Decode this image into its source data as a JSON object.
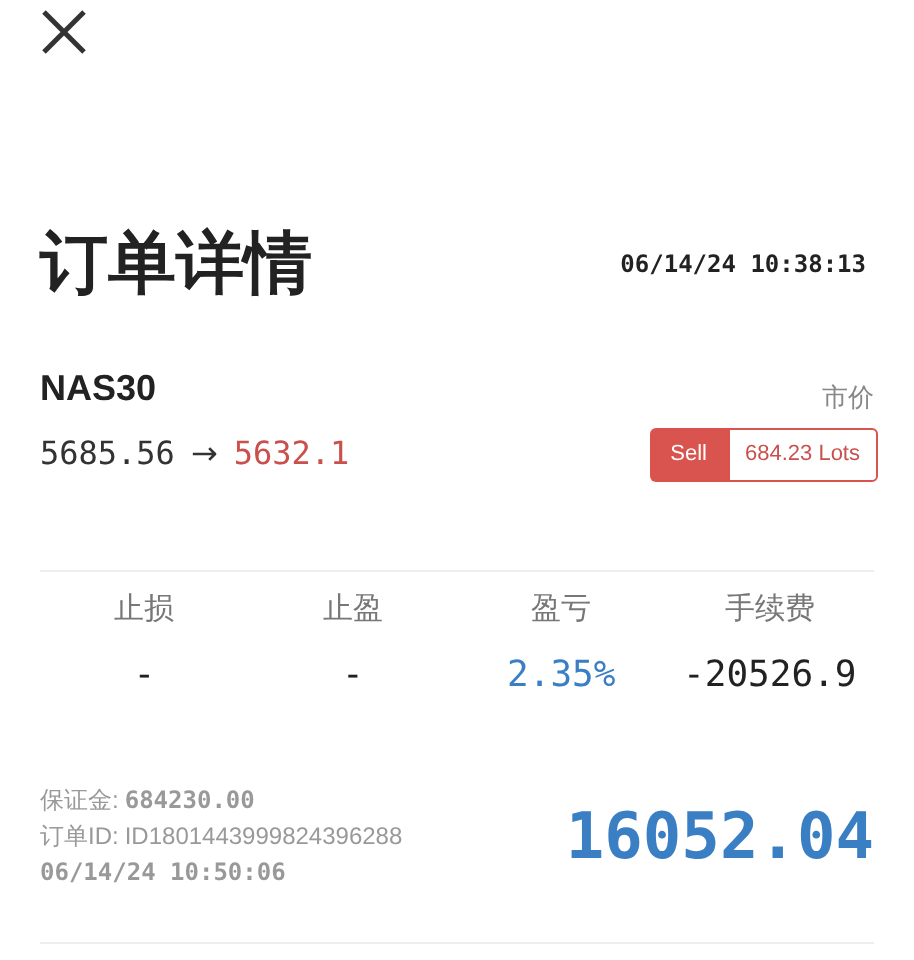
{
  "title": "订单详情",
  "time": "06/14/24 10:38:13",
  "symbol": "NAS30",
  "order_type": "市价",
  "open_price": "5685.56",
  "arrow": "→",
  "current_price": "5632.1",
  "side": {
    "label": "Sell",
    "kind": "sell"
  },
  "lots": "684.23 Lots",
  "stats": [
    {
      "label": "止损",
      "value": "-",
      "kind": "plain"
    },
    {
      "label": "止盈",
      "value": "-",
      "kind": "plain"
    },
    {
      "label": "盈亏",
      "value": "2.35%",
      "kind": "profit"
    },
    {
      "label": "手续费",
      "value": "-20526.9",
      "kind": "plain"
    }
  ],
  "margin": {
    "label": "保证金:",
    "value": "684230.00"
  },
  "order_id": {
    "label": "订单ID:",
    "value": "ID1801443999824396288"
  },
  "close_time": "06/14/24 10:50:06",
  "pnl": "16052.04"
}
